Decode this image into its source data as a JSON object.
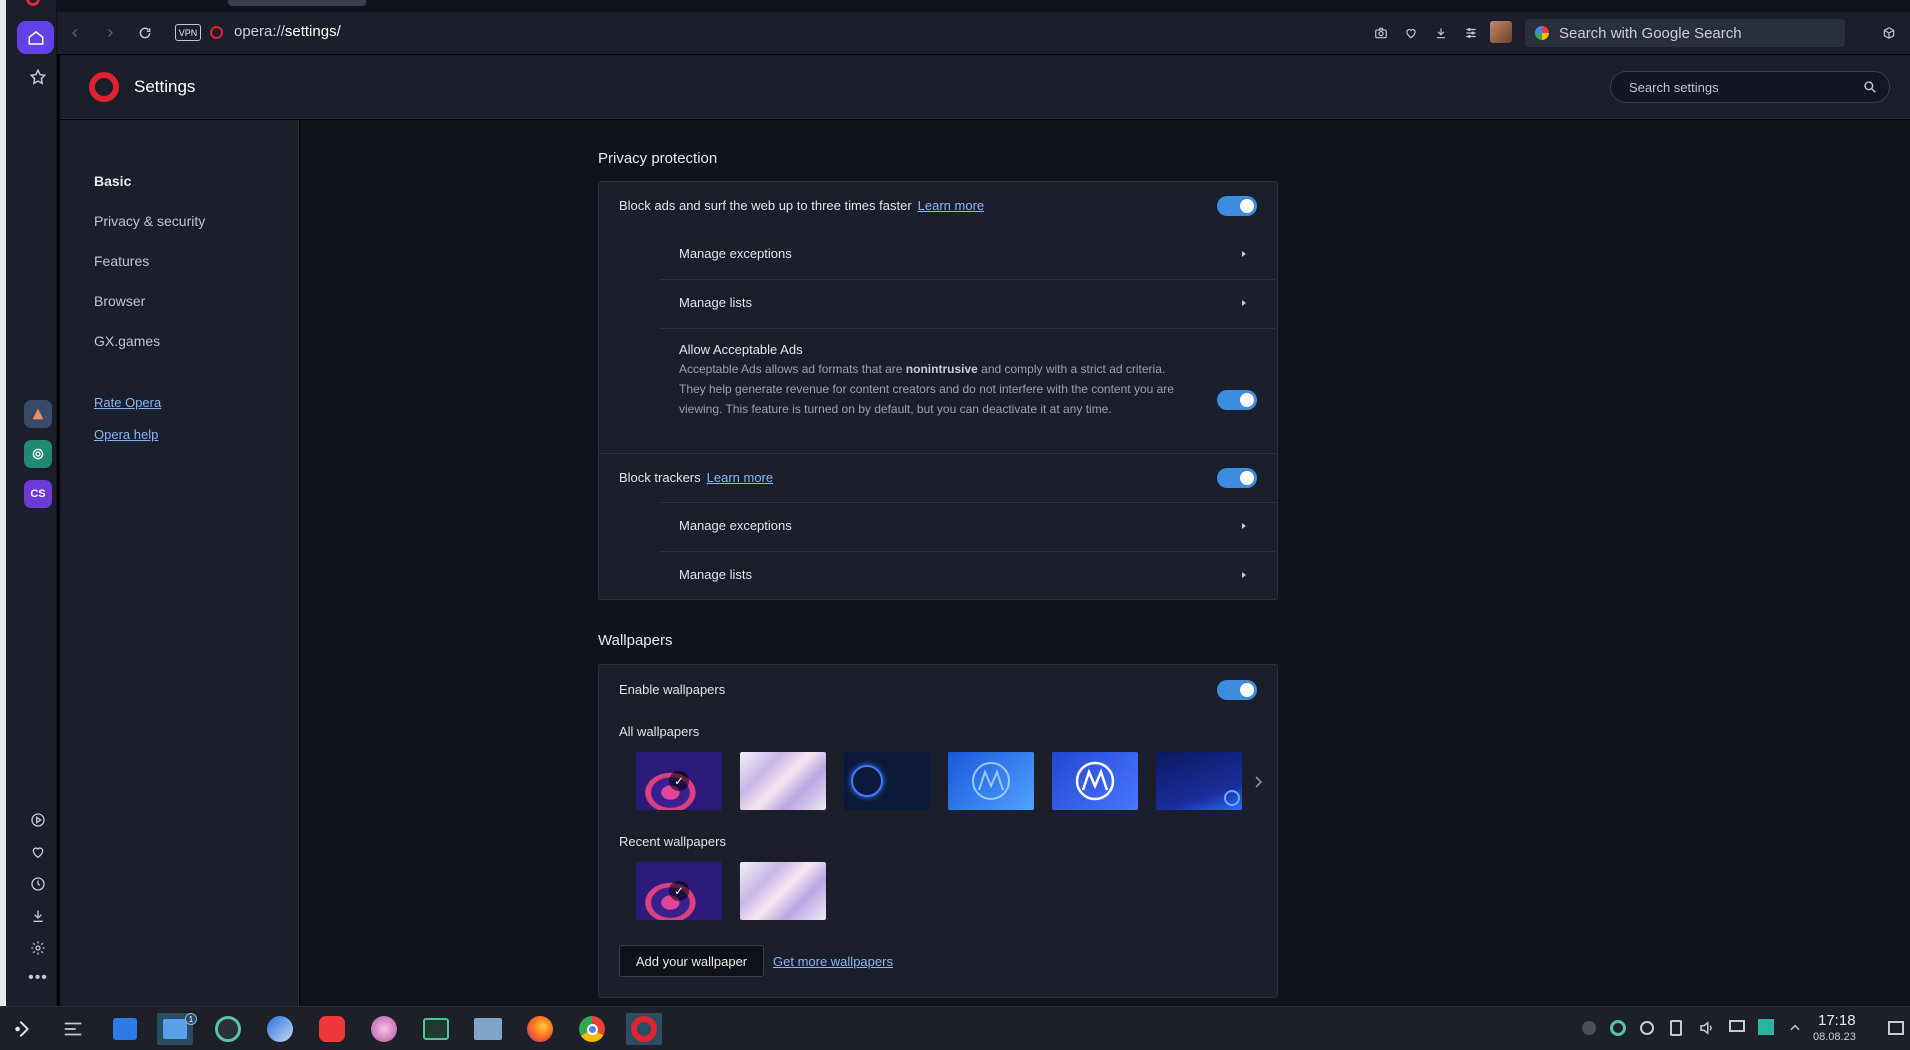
{
  "browser": {
    "url_prefix": "opera://",
    "url_path": "settings/",
    "vpn_label": "VPN",
    "omnisearch_placeholder": "Search with Google Search"
  },
  "settings_header": {
    "title": "Settings",
    "search_placeholder": "Search settings"
  },
  "left_nav": {
    "items": [
      "Basic",
      "Privacy & security",
      "Features",
      "Browser",
      "GX.games"
    ],
    "active_index": 0,
    "links": [
      "Rate Opera",
      "Opera help"
    ]
  },
  "privacy_protection": {
    "title": "Privacy protection",
    "block_ads": {
      "label": "Block ads and surf the web up to three times faster",
      "link": "Learn more",
      "enabled": true
    },
    "ads_manage_exceptions": "Manage exceptions",
    "ads_manage_lists": "Manage lists",
    "acceptable_ads": {
      "title": "Allow Acceptable Ads",
      "desc_before": "Acceptable Ads allows ad formats that are ",
      "desc_bold": "nonintrusive",
      "desc_after": " and comply with a strict ad criteria. They help generate revenue for content creators and do not interfere with the content you are viewing. This feature is turned on by default, but you can deactivate it at any time.",
      "enabled": true
    },
    "block_trackers": {
      "label": "Block trackers",
      "link": "Learn more",
      "enabled": true
    },
    "trackers_manage_exceptions": "Manage exceptions",
    "trackers_manage_lists": "Manage lists"
  },
  "wallpapers": {
    "title": "Wallpapers",
    "enable_label": "Enable wallpapers",
    "enabled": true,
    "all_label": "All wallpapers",
    "recent_label": "Recent wallpapers",
    "add_button": "Add your wallpaper",
    "more_link": "Get more wallpapers",
    "selected_check": "✓"
  },
  "taskbar": {
    "time": "17:18",
    "date": "08.08.23",
    "file_manager_badge": "1"
  },
  "colors": {
    "accent": "#3d8ce0",
    "link": "#8ab4f8",
    "sidebar_active": "#6242e6",
    "opera_red": "#e0242f"
  }
}
